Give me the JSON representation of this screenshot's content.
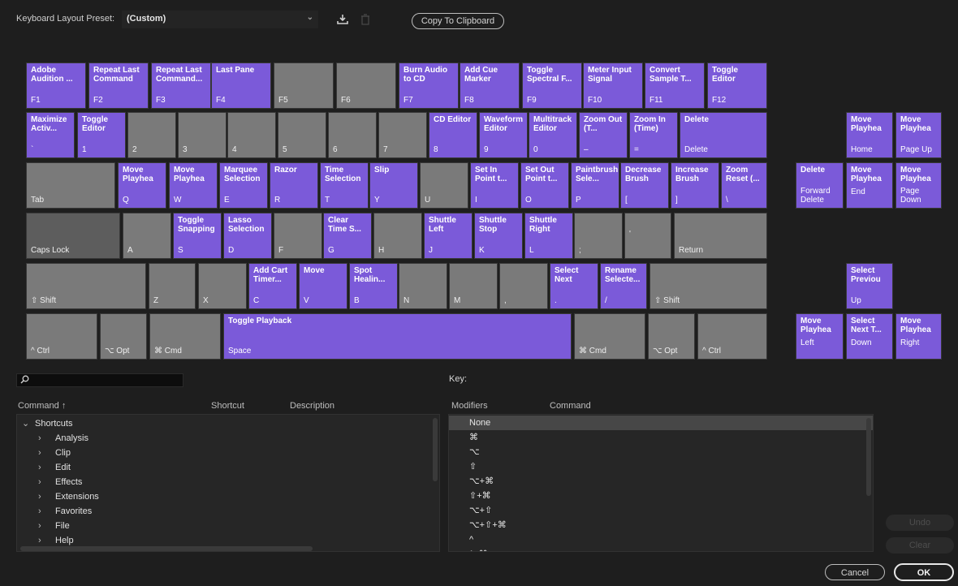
{
  "preset": {
    "label": "Keyboard Layout Preset:",
    "value": "(Custom)"
  },
  "toolbar": {
    "copy_label": "Copy To Clipboard",
    "save_icon": "save-preset-icon",
    "delete_icon": "delete-preset-icon"
  },
  "colors": {
    "assigned": "#7b5ad9",
    "unassigned": "#7a7a7a",
    "modifier": "#5d5d5d",
    "background": "#1e1e1e"
  },
  "keys": {
    "f1": {
      "cmd": "Adobe Audition ...",
      "key": "F1"
    },
    "f2": {
      "cmd": "Repeat Last Command",
      "key": "F2"
    },
    "f3": {
      "cmd": "Repeat Last Command...",
      "key": "F3"
    },
    "f4": {
      "cmd": "Last Pane",
      "key": "F4"
    },
    "f5": {
      "key": "F5"
    },
    "f6": {
      "key": "F6"
    },
    "f7": {
      "cmd": "Burn Audio to CD",
      "key": "F7"
    },
    "f8": {
      "cmd": "Add Cue Marker",
      "key": "F8"
    },
    "f9": {
      "cmd": "Toggle Spectral F...",
      "key": "F9"
    },
    "f10": {
      "cmd": "Meter Input Signal",
      "key": "F10"
    },
    "f11": {
      "cmd": "Convert Sample T...",
      "key": "F11"
    },
    "f12": {
      "cmd": "Toggle Editor",
      "key": "F12"
    },
    "backtick": {
      "cmd": "Maximize Activ...",
      "key": "`"
    },
    "n1": {
      "cmd": "Toggle Editor",
      "key": "1"
    },
    "n2": {
      "key": "2"
    },
    "n3": {
      "key": "3"
    },
    "n4": {
      "key": "4"
    },
    "n5": {
      "key": "5"
    },
    "n6": {
      "key": "6"
    },
    "n7": {
      "key": "7"
    },
    "n8": {
      "cmd": "CD Editor",
      "key": "8"
    },
    "n9": {
      "cmd": "Waveform Editor",
      "key": "9"
    },
    "n0": {
      "cmd": "Multitrack Editor",
      "key": "0"
    },
    "minus": {
      "cmd": "Zoom Out (T...",
      "key": "–"
    },
    "equals": {
      "cmd": "Zoom In (Time)",
      "key": "="
    },
    "delete": {
      "cmd": "Delete",
      "key": "Delete"
    },
    "tab": {
      "key": "Tab"
    },
    "q": {
      "cmd": "Move Playhea",
      "key": "Q"
    },
    "w": {
      "cmd": "Move Playhea",
      "key": "W"
    },
    "e": {
      "cmd": "Marquee Selection",
      "key": "E"
    },
    "r": {
      "cmd": "Razor",
      "key": "R"
    },
    "t": {
      "cmd": "Time Selection",
      "key": "T"
    },
    "y": {
      "cmd": "Slip",
      "key": "Y"
    },
    "u": {
      "key": "U"
    },
    "i": {
      "cmd": "Set In Point t...",
      "key": "I"
    },
    "o": {
      "cmd": "Set Out Point t...",
      "key": "O"
    },
    "p": {
      "cmd": "Paintbrush Sele...",
      "key": "P"
    },
    "lbracket": {
      "cmd": "Decrease Brush",
      "key": "["
    },
    "rbracket": {
      "cmd": "Increase Brush",
      "key": "]"
    },
    "backslash": {
      "cmd": "Zoom Reset (...",
      "key": "\\"
    },
    "caps": {
      "key": "Caps Lock"
    },
    "a": {
      "key": "A"
    },
    "s": {
      "cmd": "Toggle Snapping",
      "key": "S"
    },
    "d": {
      "cmd": "Lasso Selection",
      "key": "D"
    },
    "f": {
      "key": "F"
    },
    "g": {
      "cmd": "Clear Time S...",
      "key": "G"
    },
    "h": {
      "key": "H"
    },
    "j": {
      "cmd": "Shuttle Left",
      "key": "J"
    },
    "k": {
      "cmd": "Shuttle Stop",
      "key": "K"
    },
    "l": {
      "cmd": "Shuttle Right",
      "key": "L"
    },
    "semicolon": {
      "key": ";"
    },
    "quote": {
      "key": "'"
    },
    "return": {
      "key": "Return"
    },
    "lshift": {
      "key": "⇧ Shift"
    },
    "z": {
      "key": "Z"
    },
    "x": {
      "key": "X"
    },
    "c": {
      "cmd": "Add Cart Timer...",
      "key": "C"
    },
    "v": {
      "cmd": "Move",
      "key": "V"
    },
    "b": {
      "cmd": "Spot Healin...",
      "key": "B"
    },
    "n": {
      "key": "N"
    },
    "m": {
      "key": "M"
    },
    "comma": {
      "key": ","
    },
    "period": {
      "cmd": "Select Next",
      "key": "."
    },
    "slash": {
      "cmd": "Rename Selecte...",
      "key": "/"
    },
    "rshift": {
      "key": "⇧ Shift"
    },
    "lctrl": {
      "key": "^ Ctrl"
    },
    "lopt": {
      "key": "⌥ Opt"
    },
    "lcmd": {
      "key": "⌘ Cmd"
    },
    "space": {
      "cmd": "Toggle Playback",
      "key": "Space"
    },
    "rcmd": {
      "key": "⌘ Cmd"
    },
    "ropt": {
      "key": "⌥ Opt"
    },
    "rctrl": {
      "key": "^ Ctrl"
    },
    "home": {
      "cmd": "Move Playhea",
      "key": "Home"
    },
    "pageup": {
      "cmd": "Move Playhea",
      "key": "Page Up"
    },
    "fwddel": {
      "cmd": "Delete",
      "key": "Forward Delete"
    },
    "end": {
      "cmd": "Move Playhea",
      "key": "End"
    },
    "pagedown": {
      "cmd": "Move Playhea",
      "key": "Page Down"
    },
    "up": {
      "cmd": "Select Previou",
      "key": "Up"
    },
    "left": {
      "cmd": "Move Playhea",
      "key": "Left"
    },
    "down": {
      "cmd": "Select Next T...",
      "key": "Down"
    },
    "right": {
      "cmd": "Move Playhea",
      "key": "Right"
    }
  },
  "search": {
    "placeholder": ""
  },
  "commands": {
    "col_command": "Command",
    "col_shortcut": "Shortcut",
    "col_description": "Description",
    "root": "Shortcuts",
    "groups": [
      "Analysis",
      "Clip",
      "Edit",
      "Effects",
      "Extensions",
      "Favorites",
      "File",
      "Help"
    ]
  },
  "key_panel": {
    "label": "Key:",
    "col_modifiers": "Modifiers",
    "col_command": "Command",
    "modifiers": [
      "None",
      "⌘",
      "⌥",
      "⇧",
      "⌥+⌘",
      "⇧+⌘",
      "⌥+⇧",
      "⌥+⇧+⌘",
      "^",
      "^+⌘"
    ]
  },
  "buttons": {
    "undo": "Undo",
    "clear": "Clear",
    "cancel": "Cancel",
    "ok": "OK"
  }
}
